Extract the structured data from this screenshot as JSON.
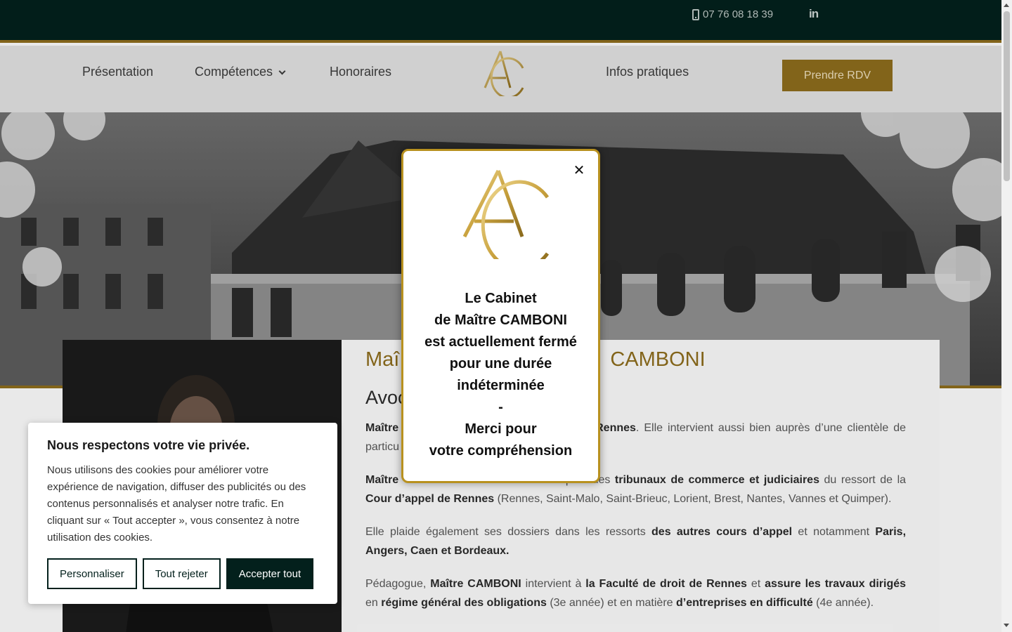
{
  "topbar": {
    "phone": "07 76 08 18 39",
    "phone_icon": "phone-icon",
    "social_icon": "linkedin-icon"
  },
  "nav": {
    "items": [
      {
        "label": "Présentation"
      },
      {
        "label": "Compétences",
        "has_dropdown": true
      },
      {
        "label": "Honoraires"
      },
      {
        "label": "Infos pratiques"
      }
    ],
    "cta": "Prendre RDV"
  },
  "content": {
    "title_start": "Maî",
    "title_end": "CAMBONI",
    "subtitle": "Avoc",
    "p1_a": "Maître",
    "p1_b": "Rennes",
    "p1_c": ". Elle intervient aussi bien auprès d’une clientèle de",
    "p1_d": "particu",
    "p2_a": "Maître",
    "p2_b": "auprès des",
    "p2_c": "tribunaux de commerce et judiciaires",
    "p2_d": "du ressort de la",
    "p2_e": "Cour d’appel de Rennes",
    "p2_f": "(Rennes, Saint-Malo, Saint-Brieuc, Lorient, Brest, Nantes, Vannes et Quimper).",
    "p3_a": "Elle plaide également ses dossiers dans les ressorts",
    "p3_b": "des autres cours d’appel",
    "p3_c": "et notamment",
    "p3_d": "Paris, Angers, Caen et Bordeaux.",
    "p4_a": "Pédagogue,",
    "p4_b": "Maître CAMBONI",
    "p4_c": "intervient à",
    "p4_d": "la Faculté de droit de Rennes",
    "p4_e": "et",
    "p4_f": "assure les travaux dirigés",
    "p4_g": "en",
    "p4_h": "régime général des obligations",
    "p4_i": "(3e année) et en matière",
    "p4_j": "d’entreprises en difficulté",
    "p4_k": "(4e année)."
  },
  "modal": {
    "close_symbol": "✕",
    "lines": [
      "Le Cabinet",
      "de Maître CAMBONI",
      "est actuellement fermé",
      "pour une durée",
      "indéterminée",
      "-",
      "Merci pour",
      "votre compréhension"
    ]
  },
  "cookie": {
    "title": "Nous respectons votre vie privée.",
    "text": "Nous utilisons des cookies pour améliorer votre expérience de navigation, diffuser des publicités ou des contenus personnalisés et analyser notre trafic. En cliquant sur « Tout accepter », vous consentez à notre utilisation des cookies.",
    "buttons": {
      "customize": "Personnaliser",
      "reject": "Tout rejeter",
      "accept": "Accepter tout"
    }
  },
  "colors": {
    "dark_green": "#03201c",
    "gold": "#8a6a1c",
    "modal_border": "#b8911f"
  }
}
